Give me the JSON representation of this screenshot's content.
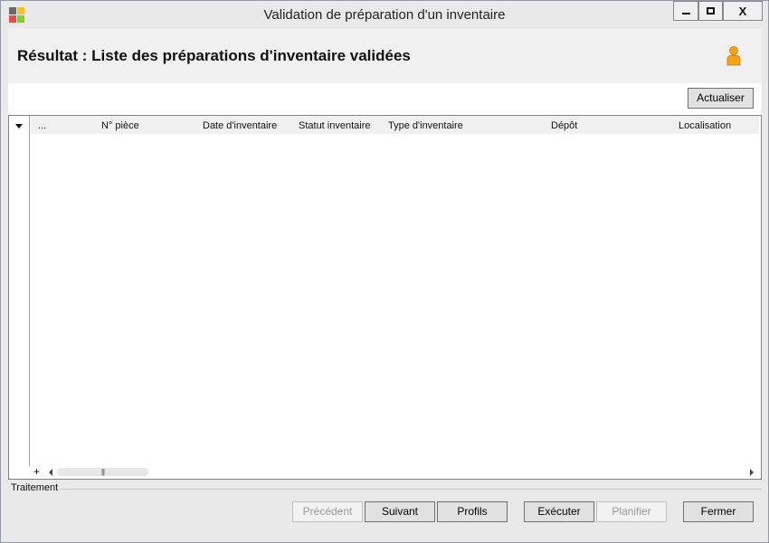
{
  "window": {
    "title": "Validation de préparation d'un inventaire",
    "close_glyph": "X"
  },
  "header": {
    "title": "Résultat : Liste des préparations d'inventaire validées",
    "user_icon": "user-icon"
  },
  "toolbar": {
    "refresh_label": "Actualiser"
  },
  "grid": {
    "columns": [
      "...",
      "N° pièce",
      "Date d'inventaire",
      "Statut inventaire",
      "Type d'inventaire",
      "Dépôt",
      "Localisation"
    ],
    "rows": [],
    "add_glyph": "+",
    "scroll_grip": "|||"
  },
  "footer": {
    "section_label": "Traitement",
    "buttons": {
      "previous": "Précédent",
      "next": "Suivant",
      "profiles": "Profils",
      "execute": "Exécuter",
      "schedule": "Planifier",
      "close": "Fermer"
    }
  },
  "colors": {
    "window_bg": "#e9e9e9",
    "header_band": "#f0f0f0",
    "user_icon": "#f5a30f"
  }
}
